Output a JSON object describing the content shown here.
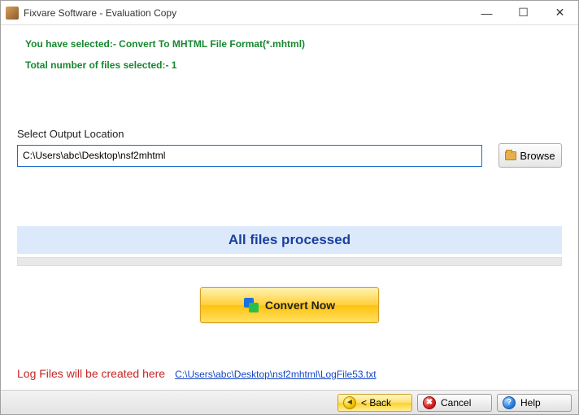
{
  "window": {
    "title": "Fixvare Software - Evaluation Copy"
  },
  "info": {
    "line1": "You have selected:- Convert To MHTML File Format(*.mhtml)",
    "line2": "Total number of files selected:- 1"
  },
  "output": {
    "label": "Select Output Location",
    "value": "C:\\Users\\abc\\Desktop\\nsf2mhtml"
  },
  "buttons": {
    "browse": "Browse",
    "convert": "Convert Now",
    "back": "<  Back",
    "cancel": "Cancel",
    "help": "Help"
  },
  "status": {
    "text": "All files processed"
  },
  "log": {
    "label": "Log Files will be created here",
    "path": "C:\\Users\\abc\\Desktop\\nsf2mhtml\\LogFile53.txt"
  }
}
